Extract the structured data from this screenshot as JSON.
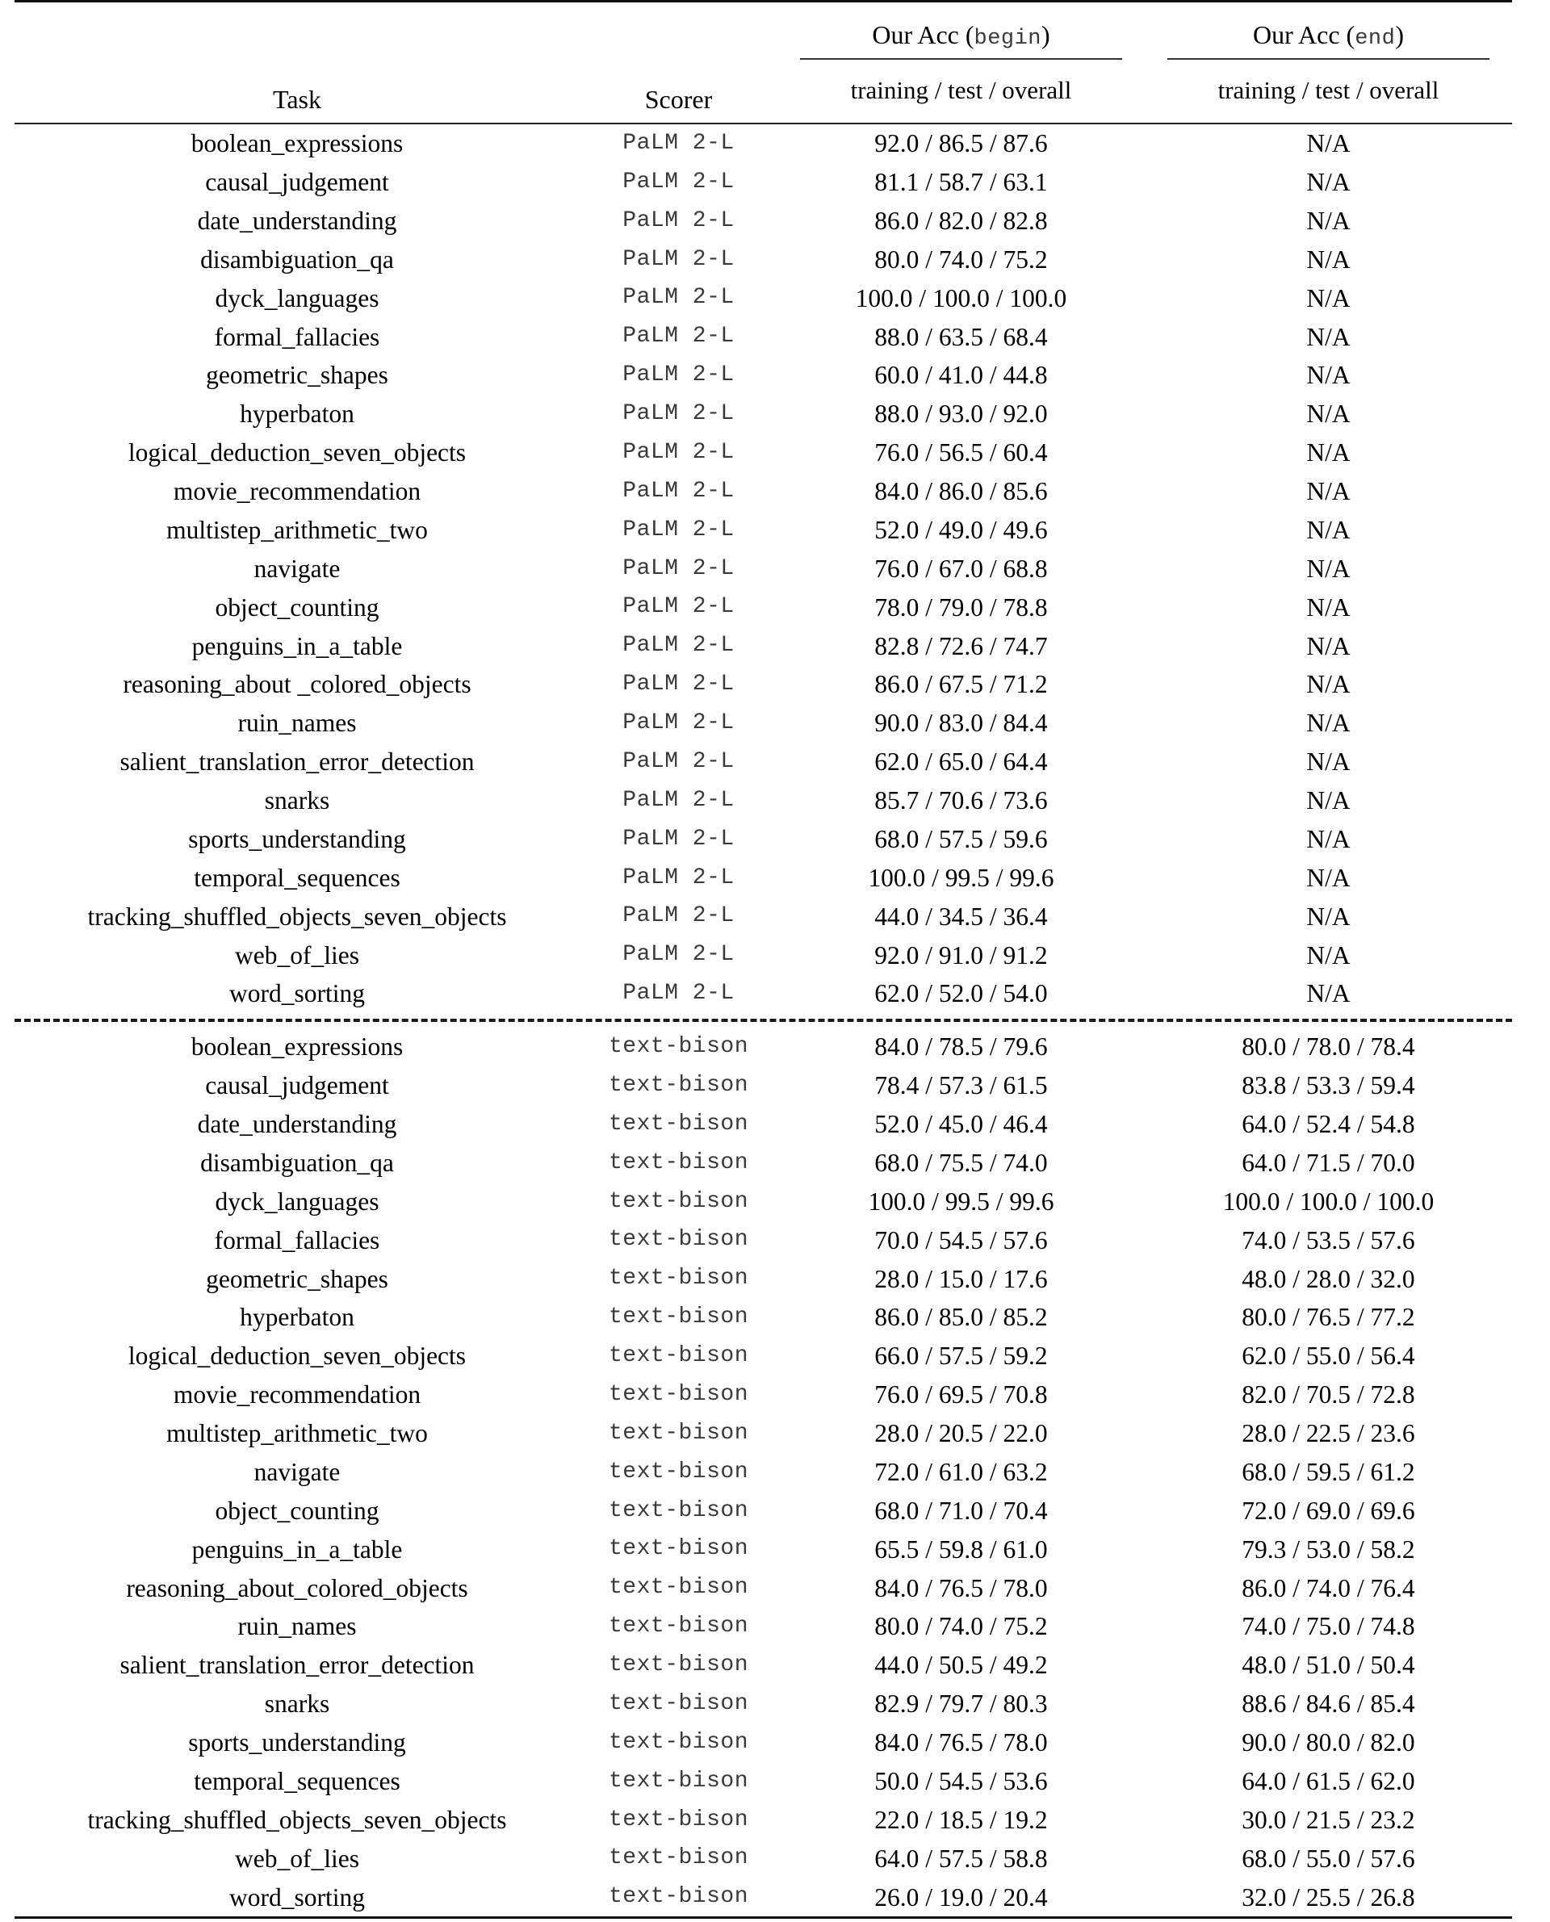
{
  "table": {
    "headers": {
      "task": "Task",
      "scorer": "Scorer",
      "group_begin_prefix": "Our Acc (",
      "group_begin_mono": "begin",
      "group_begin_suffix": ")",
      "group_end_prefix": "Our Acc (",
      "group_end_mono": "end",
      "group_end_suffix": ")",
      "sub_begin": "training / test / overall",
      "sub_end": "training / test / overall"
    },
    "sections": [
      {
        "id": "palm-2-l",
        "scorer_label": "PaLM 2-L",
        "rows": [
          {
            "task": "boolean_expressions",
            "scorer": "PaLM 2-L",
            "begin": "92.0 / 86.5 / 87.6",
            "end": "N/A"
          },
          {
            "task": "causal_judgement",
            "scorer": "PaLM 2-L",
            "begin": "81.1 / 58.7 / 63.1",
            "end": "N/A"
          },
          {
            "task": "date_understanding",
            "scorer": "PaLM 2-L",
            "begin": "86.0 / 82.0 / 82.8",
            "end": "N/A"
          },
          {
            "task": "disambiguation_qa",
            "scorer": "PaLM 2-L",
            "begin": "80.0 / 74.0 / 75.2",
            "end": "N/A"
          },
          {
            "task": "dyck_languages",
            "scorer": "PaLM 2-L",
            "begin": "100.0 / 100.0 / 100.0",
            "end": "N/A"
          },
          {
            "task": "formal_fallacies",
            "scorer": "PaLM 2-L",
            "begin": "88.0 / 63.5 / 68.4",
            "end": "N/A"
          },
          {
            "task": "geometric_shapes",
            "scorer": "PaLM 2-L",
            "begin": "60.0 / 41.0 / 44.8",
            "end": "N/A"
          },
          {
            "task": "hyperbaton",
            "scorer": "PaLM 2-L",
            "begin": "88.0 / 93.0 / 92.0",
            "end": "N/A"
          },
          {
            "task": "logical_deduction_seven_objects",
            "scorer": "PaLM 2-L",
            "begin": "76.0 / 56.5 / 60.4",
            "end": "N/A"
          },
          {
            "task": "movie_recommendation",
            "scorer": "PaLM 2-L",
            "begin": "84.0 / 86.0 / 85.6",
            "end": "N/A"
          },
          {
            "task": "multistep_arithmetic_two",
            "scorer": "PaLM 2-L",
            "begin": "52.0 / 49.0 / 49.6",
            "end": "N/A"
          },
          {
            "task": "navigate",
            "scorer": "PaLM 2-L",
            "begin": "76.0 / 67.0 / 68.8",
            "end": "N/A"
          },
          {
            "task": "object_counting",
            "scorer": "PaLM 2-L",
            "begin": "78.0 / 79.0 / 78.8",
            "end": "N/A"
          },
          {
            "task": "penguins_in_a_table",
            "scorer": "PaLM 2-L",
            "begin": "82.8 / 72.6 / 74.7",
            "end": "N/A"
          },
          {
            "task": "reasoning_about _colored_objects",
            "scorer": "PaLM 2-L",
            "begin": "86.0 / 67.5 / 71.2",
            "end": "N/A"
          },
          {
            "task": "ruin_names",
            "scorer": "PaLM 2-L",
            "begin": "90.0 / 83.0 / 84.4",
            "end": "N/A"
          },
          {
            "task": "salient_translation_error_detection",
            "scorer": "PaLM 2-L",
            "begin": "62.0 / 65.0 / 64.4",
            "end": "N/A"
          },
          {
            "task": "snarks",
            "scorer": "PaLM 2-L",
            "begin": "85.7 / 70.6 / 73.6",
            "end": "N/A"
          },
          {
            "task": "sports_understanding",
            "scorer": "PaLM 2-L",
            "begin": "68.0 / 57.5 / 59.6",
            "end": "N/A"
          },
          {
            "task": "temporal_sequences",
            "scorer": "PaLM 2-L",
            "begin": "100.0 / 99.5 / 99.6",
            "end": "N/A"
          },
          {
            "task": "tracking_shuffled_objects_seven_objects",
            "scorer": "PaLM 2-L",
            "begin": "44.0 / 34.5 / 36.4",
            "end": "N/A"
          },
          {
            "task": "web_of_lies",
            "scorer": "PaLM 2-L",
            "begin": "92.0 / 91.0 / 91.2",
            "end": "N/A"
          },
          {
            "task": "word_sorting",
            "scorer": "PaLM 2-L",
            "begin": "62.0 / 52.0 / 54.0",
            "end": "N/A"
          }
        ]
      },
      {
        "id": "text-bison",
        "scorer_label": "text-bison",
        "rows": [
          {
            "task": "boolean_expressions",
            "scorer": "text-bison",
            "begin": "84.0 / 78.5 / 79.6",
            "end": "80.0 / 78.0 / 78.4"
          },
          {
            "task": "causal_judgement",
            "scorer": "text-bison",
            "begin": "78.4 / 57.3 / 61.5",
            "end": "83.8 / 53.3 / 59.4"
          },
          {
            "task": "date_understanding",
            "scorer": "text-bison",
            "begin": "52.0 / 45.0 / 46.4",
            "end": "64.0 / 52.4 / 54.8"
          },
          {
            "task": "disambiguation_qa",
            "scorer": "text-bison",
            "begin": "68.0 / 75.5 / 74.0",
            "end": "64.0 / 71.5 / 70.0"
          },
          {
            "task": "dyck_languages",
            "scorer": "text-bison",
            "begin": "100.0 / 99.5 / 99.6",
            "end": "100.0 / 100.0 / 100.0"
          },
          {
            "task": "formal_fallacies",
            "scorer": "text-bison",
            "begin": "70.0 / 54.5 / 57.6",
            "end": "74.0 / 53.5 / 57.6"
          },
          {
            "task": "geometric_shapes",
            "scorer": "text-bison",
            "begin": "28.0 / 15.0 / 17.6",
            "end": "48.0 / 28.0 / 32.0"
          },
          {
            "task": "hyperbaton",
            "scorer": "text-bison",
            "begin": "86.0 / 85.0 / 85.2",
            "end": "80.0 / 76.5 / 77.2"
          },
          {
            "task": "logical_deduction_seven_objects",
            "scorer": "text-bison",
            "begin": "66.0 / 57.5 / 59.2",
            "end": "62.0 / 55.0 / 56.4"
          },
          {
            "task": "movie_recommendation",
            "scorer": "text-bison",
            "begin": "76.0 / 69.5 / 70.8",
            "end": "82.0 / 70.5 / 72.8"
          },
          {
            "task": "multistep_arithmetic_two",
            "scorer": "text-bison",
            "begin": "28.0 / 20.5 / 22.0",
            "end": "28.0 / 22.5 / 23.6"
          },
          {
            "task": "navigate",
            "scorer": "text-bison",
            "begin": "72.0 / 61.0 / 63.2",
            "end": "68.0 / 59.5 / 61.2"
          },
          {
            "task": "object_counting",
            "scorer": "text-bison",
            "begin": "68.0 / 71.0 / 70.4",
            "end": "72.0 / 69.0 / 69.6"
          },
          {
            "task": "penguins_in_a_table",
            "scorer": "text-bison",
            "begin": "65.5 / 59.8 / 61.0",
            "end": "79.3 / 53.0 / 58.2"
          },
          {
            "task": "reasoning_about_colored_objects",
            "scorer": "text-bison",
            "begin": "84.0 / 76.5 / 78.0",
            "end": "86.0 / 74.0 / 76.4"
          },
          {
            "task": "ruin_names",
            "scorer": "text-bison",
            "begin": "80.0 / 74.0 / 75.2",
            "end": "74.0 / 75.0 / 74.8"
          },
          {
            "task": "salient_translation_error_detection",
            "scorer": "text-bison",
            "begin": "44.0 / 50.5 / 49.2",
            "end": "48.0 / 51.0 / 50.4"
          },
          {
            "task": "snarks",
            "scorer": "text-bison",
            "begin": "82.9 / 79.7 / 80.3",
            "end": "88.6 / 84.6 / 85.4"
          },
          {
            "task": "sports_understanding",
            "scorer": "text-bison",
            "begin": "84.0 / 76.5 / 78.0",
            "end": "90.0 / 80.0 / 82.0"
          },
          {
            "task": "temporal_sequences",
            "scorer": "text-bison",
            "begin": "50.0 / 54.5 / 53.6",
            "end": "64.0 / 61.5 / 62.0"
          },
          {
            "task": "tracking_shuffled_objects_seven_objects",
            "scorer": "text-bison",
            "begin": "22.0 / 18.5 / 19.2",
            "end": "30.0 / 21.5 / 23.2"
          },
          {
            "task": "web_of_lies",
            "scorer": "text-bison",
            "begin": "64.0 / 57.5 / 58.8",
            "end": "68.0 / 55.0 / 57.6"
          },
          {
            "task": "word_sorting",
            "scorer": "text-bison",
            "begin": "26.0 / 19.0 / 20.4",
            "end": "32.0 / 25.5 / 26.8"
          }
        ]
      }
    ]
  },
  "colors": {
    "text": "#000000",
    "mono_text": "#3a3a3a",
    "rule": "#111111"
  }
}
